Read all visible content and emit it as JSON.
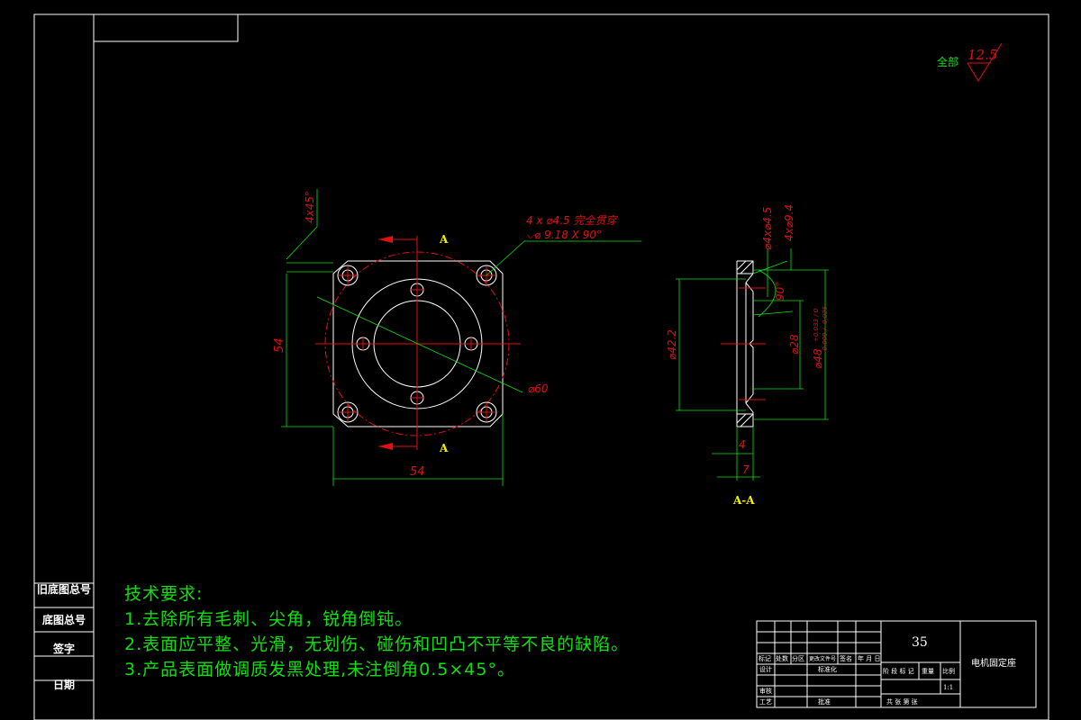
{
  "drawing": {
    "roughness_label": "全部",
    "roughness_value": "12.5",
    "section_marker_top": "A",
    "section_marker_bottom": "A",
    "section_label": "A-A",
    "hole_callout_line1": "4 x ⌀4.5 完全贯穿",
    "hole_callout_line2": "⌵⌀ 9.18 X 90°",
    "dim_chamfer": "4x45°",
    "dim_height": "54",
    "dim_width": "54",
    "dim_bolt_circle": "⌀60",
    "dim_section_dia": "⌀42.2",
    "dim_hole_dia": "⌀4x⌀4.5",
    "dim_cbore_dia": "4x⌀9.4",
    "dim_angle": "90°",
    "dim_bore": "⌀28",
    "dim_bore_tol": "+0.033 / 0",
    "dim_outer": "⌀48",
    "dim_outer_tol": "-0.009 / -0.025",
    "dim_thick_inner": "4",
    "dim_thick_total": "7"
  },
  "tech_requirements": {
    "title": "技术要求:",
    "items": [
      "1.去除所有毛刺、尖角，锐角倒钝。",
      "2.表面应平整、光滑，无划伤、碰伤和凹凸不平等不良的缺陷。",
      "3.产品表面做调质发黑处理,未注倒角0.5×45°。"
    ]
  },
  "side_labels": [
    "旧底图总号",
    "底图总号",
    "签字",
    "日期"
  ],
  "title_block": {
    "material": "35",
    "part_name": "电机固定座",
    "row_labels": [
      "标记",
      "处数",
      "分区",
      "更改文件号",
      "签名",
      "年 月 日"
    ],
    "designer": "设计",
    "checker": "审核",
    "process": "工艺",
    "std_label": "标准化",
    "approve": "批准",
    "stage": "阶 段 标 记",
    "weight": "重量",
    "scale": "比例",
    "scale_value": "1:1",
    "sheets": "共  张  第  张"
  }
}
